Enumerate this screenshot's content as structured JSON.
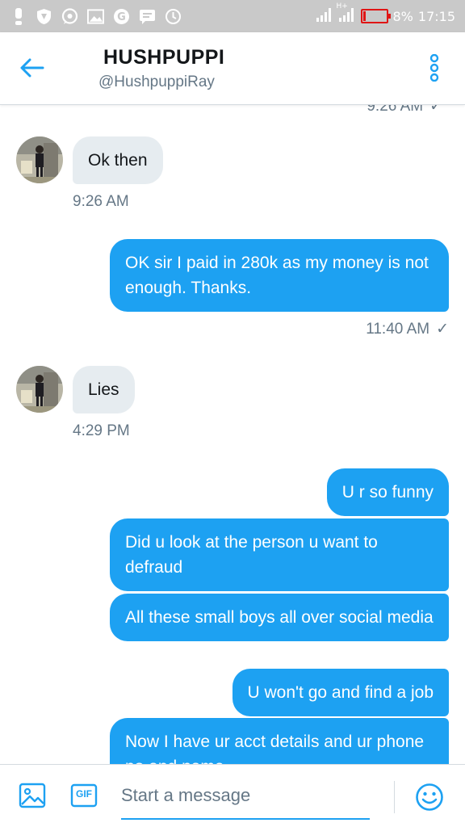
{
  "status_bar": {
    "left_icons": [
      "alert-icon",
      "shield-icon",
      "whatsapp-icon",
      "image-icon",
      "opera-icon",
      "message-icon",
      "clock-icon"
    ],
    "signal_label": "H+",
    "battery_percent": "8%",
    "time": "17:15"
  },
  "header": {
    "title": "HUSHPUPPI",
    "handle": "@HushpuppiRay"
  },
  "conversation": {
    "cut_timestamp": "9:26 AM",
    "messages": [
      {
        "direction": "in",
        "text": "Ok then",
        "timestamp": "9:26 AM"
      },
      {
        "direction": "out",
        "text": "OK sir I paid in 280k as my money is not enough. Thanks.",
        "timestamp": "11:40 AM"
      },
      {
        "direction": "in",
        "text": "Lies",
        "timestamp": "4:29 PM"
      },
      {
        "direction": "out",
        "text": "U r so funny"
      },
      {
        "direction": "out",
        "text": "Did u look at the person u want to defraud"
      },
      {
        "direction": "out",
        "text": "All these small boys all over social media"
      },
      {
        "direction": "out",
        "text": "U won't go and find a job"
      },
      {
        "direction": "out",
        "text": "Now I have ur acct details and ur phone no and name"
      }
    ]
  },
  "composer": {
    "placeholder": "Start a message",
    "gif_label": "GIF"
  },
  "colors": {
    "accent": "#1da1f2",
    "incoming_bubble": "#e6ecf0",
    "secondary_text": "#657786",
    "battery_low": "#e01515"
  }
}
